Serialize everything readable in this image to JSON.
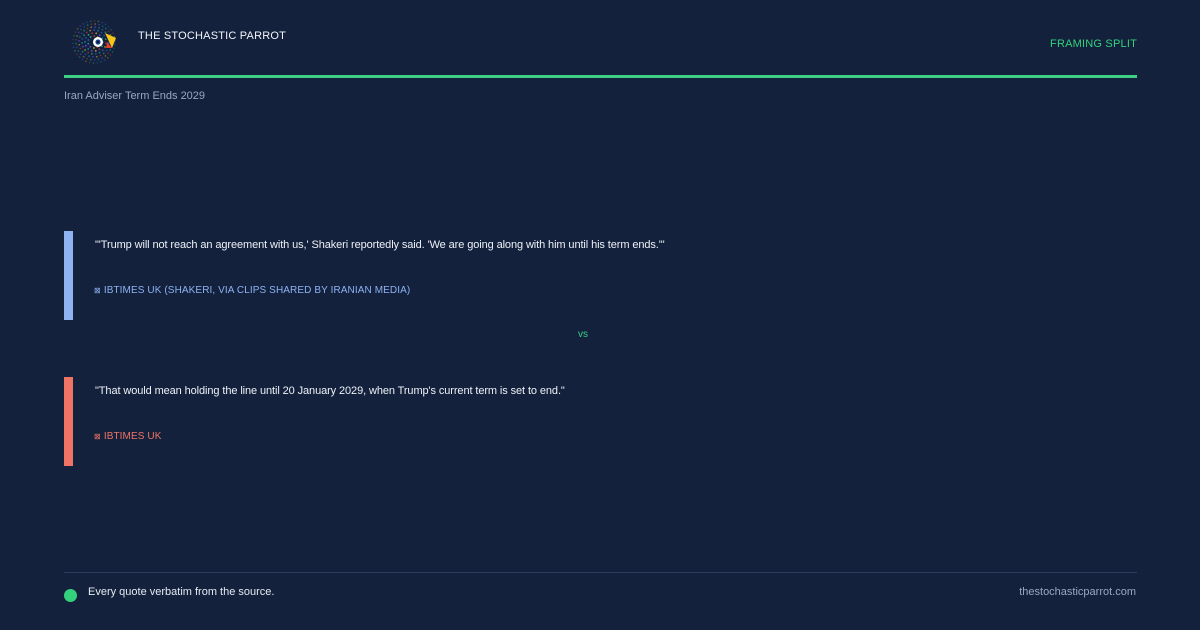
{
  "header": {
    "brand": "THE STOCHASTIC PARROT",
    "tag": "FRAMING SPLIT",
    "subtitle": "Iran Adviser Term Ends 2029"
  },
  "quotes": [
    {
      "text": "\"'Trump will not reach an agreement with us,' Shakeri reportedly said. 'We are going along with him until his term ends.'\"",
      "source_icon": "⊠",
      "source": "IBTIMES UK (SHAKERI, VIA CLIPS SHARED BY IRANIAN MEDIA)",
      "accent": "#8db3f3"
    },
    {
      "text": "\"That would mean holding the line until 20 January 2029, when Trump's current term is set to end.\"",
      "source_icon": "⊠",
      "source": "IBTIMES UK",
      "accent": "#ef7466"
    }
  ],
  "divider": {
    "label": "vs"
  },
  "footer": {
    "note": "Every quote verbatim from the source.",
    "site": "thestochasticparrot.com"
  },
  "colors": {
    "background": "#13213c",
    "accent_green": "#3ecf85"
  }
}
